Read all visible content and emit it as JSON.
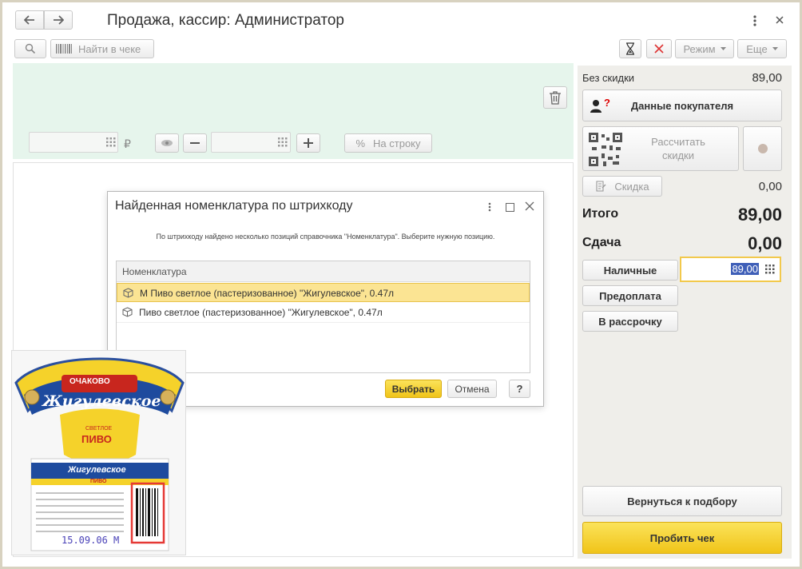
{
  "window": {
    "title": "Продажа, кассир: Администратор"
  },
  "toolbar": {
    "find_in_receipt": "Найти в чеке",
    "mode": "Режим",
    "more": "Еще"
  },
  "edit_area": {
    "currency": "₽",
    "per_row": "На строку"
  },
  "summary": {
    "no_discount_label": "Без скидки",
    "no_discount_value": "89,00",
    "buyer_data": "Данные покупателя",
    "calc_discounts": "Рассчитать скидки",
    "discount_label": "Скидка",
    "discount_value": "0,00",
    "total_label": "Итого",
    "total_value": "89,00",
    "change_label": "Сдача",
    "change_value": "0,00",
    "cash_label": "Наличные",
    "cash_value": "89,00",
    "prepayment": "Предоплата",
    "installment": "В рассрочку",
    "back_to_selection": "Вернуться к подбору",
    "print_receipt": "Пробить чек"
  },
  "dialog": {
    "title": "Найденная номенклатура по штрихкоду",
    "message": "По штрихкоду найдено несколько позиций справочника \"Номенклатура\". Выберите нужную позицию.",
    "column_header": "Номенклатура",
    "rows": [
      {
        "text": "М Пиво светлое (пастеризованное) \"Жигулевское\", 0.47л",
        "selected": true
      },
      {
        "text": "Пиво светлое (пастеризованное) \"Жигулевское\", 0.47л",
        "selected": false
      }
    ],
    "select_button": "Выбрать",
    "cancel_button": "Отмена",
    "help_button": "?"
  },
  "label_image": {
    "brand": "ОЧАКОВО",
    "name": "Жигулевское",
    "type_top": "СВЕТЛОЕ",
    "type": "ПИВО",
    "name_small": "Жигулевское",
    "type_small": "ПИВО",
    "date_stamp": "15.09.06 М"
  },
  "colors": {
    "accent_yellow": "#f5d22a",
    "edit_area_bg": "#e6f5ec",
    "panel_bg": "#efeeea",
    "selection_bg": "#fbe493"
  }
}
